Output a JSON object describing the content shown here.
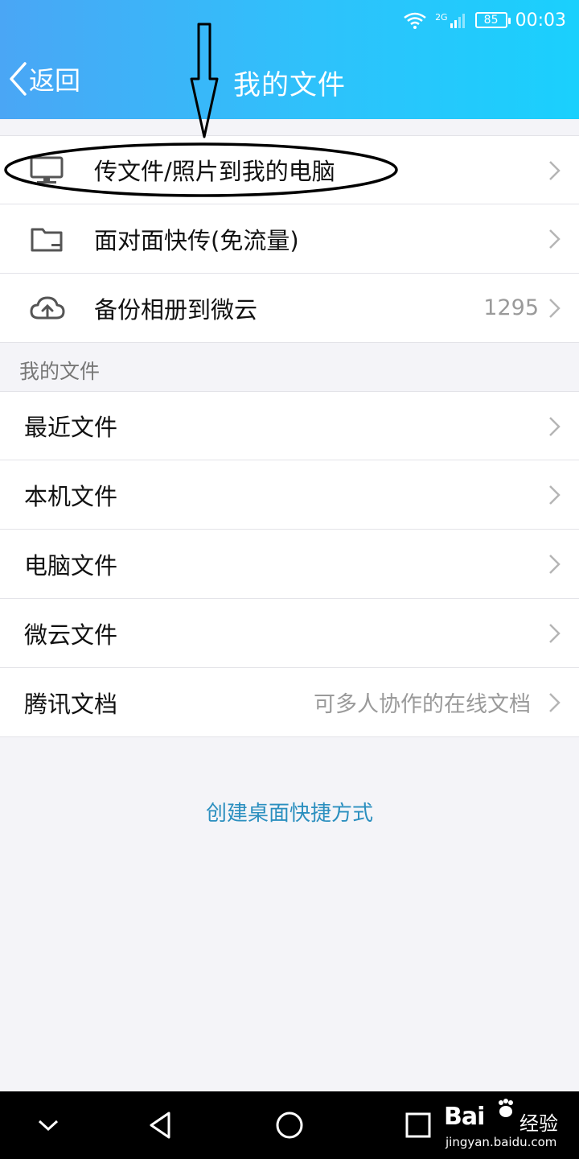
{
  "status_bar": {
    "network": "2G",
    "battery": "85",
    "time": "00:03"
  },
  "header": {
    "back_label": "返回",
    "title": "我的文件"
  },
  "quick_actions": [
    {
      "label": "传文件/照片到我的电脑",
      "icon": "computer-monitor-icon",
      "value": ""
    },
    {
      "label": "面对面快传(免流量)",
      "icon": "folder-icon",
      "value": ""
    },
    {
      "label": "备份相册到微云",
      "icon": "cloud-upload-icon",
      "value": "1295"
    }
  ],
  "section_title": "我的文件",
  "file_items": [
    {
      "label": "最近文件",
      "value": ""
    },
    {
      "label": "本机文件",
      "value": ""
    },
    {
      "label": "电脑文件",
      "value": ""
    },
    {
      "label": "微云文件",
      "value": ""
    },
    {
      "label": "腾讯文档",
      "value": "可多人协作的在线文档"
    }
  ],
  "shortcut_link": "创建桌面快捷方式",
  "nav_icons": [
    "chevron-down-icon",
    "back-triangle-icon",
    "home-circle-icon",
    "recents-square-icon"
  ],
  "watermark": {
    "logo": "Bai",
    "logo_suffix": "经验",
    "url": "jingyan.baidu.com"
  },
  "colors": {
    "header_start": "#4aa6f5",
    "header_end": "#1ad0fd",
    "link": "#2b8fbf",
    "annotation": "#000000"
  }
}
